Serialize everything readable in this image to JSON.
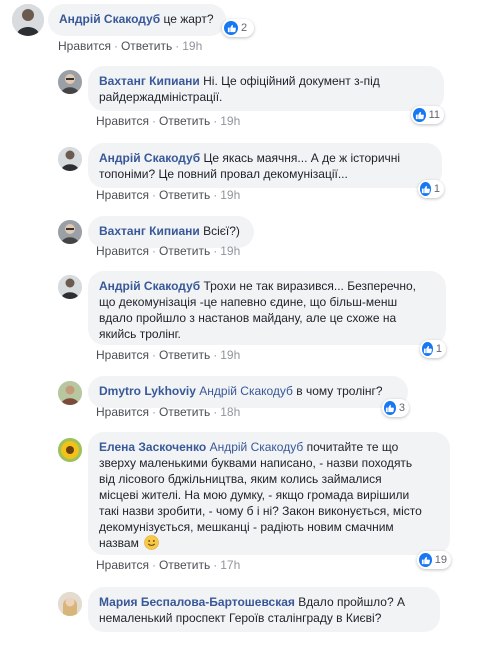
{
  "actions": {
    "like": "Нравится",
    "reply": "Ответить",
    "separator": "·"
  },
  "colors": {
    "author": "#385898",
    "bubble": "#f2f3f5",
    "like_badge": "#1877f2"
  },
  "comments": [
    {
      "author": "Андрій Скакодуб",
      "mention": "",
      "lines": [
        "це жарт?"
      ],
      "time": "19h",
      "likes": "2",
      "avatar": "avatar-man-dark-jacket"
    },
    {
      "author": "Вахтанг Кипиани",
      "mention": "",
      "lines": [
        "Ні. Це офіційний документ з-під",
        "райдержадміністрації."
      ],
      "time": "19h",
      "likes": "11",
      "avatar": "avatar-man-glasses"
    },
    {
      "author": "Андрій Скакодуб",
      "mention": "",
      "lines": [
        "Це якась маячня... А де ж історичні",
        "топоніми? Це повний провал декомунізації..."
      ],
      "time": "19h",
      "likes": "1",
      "avatar": "avatar-man-dark-jacket"
    },
    {
      "author": "Вахтанг Кипиани",
      "mention": "",
      "lines": [
        "Всієї?)"
      ],
      "time": "19h",
      "likes": "",
      "avatar": "avatar-man-glasses"
    },
    {
      "author": "Андрій Скакодуб",
      "mention": "",
      "lines": [
        "Трохи не так виразився... Безперечно,",
        "що декомунізація -це напевно єдине, що більш-менш",
        "вдало пройшло з настанов майдану, але це схоже на",
        "якийсь тролінг."
      ],
      "time": "19h",
      "likes": "1",
      "avatar": "avatar-man-dark-jacket"
    },
    {
      "author": "Dmytro Lykhoviy",
      "mention": "Андрій Скакодуб",
      "lines": [
        "в чому тролінг?"
      ],
      "time": "18h",
      "likes": "3",
      "avatar": "avatar-man-outdoor"
    },
    {
      "author": "Елена Заскоченко",
      "mention": "Андрій Скакодуб",
      "lines": [
        "почитайте те що",
        "зверху маленькими буквами написано, - назви походять",
        "від лісового бджільництва, яким колись займалися",
        "місцеві жителі. На мою думку, - якщо громада вирішили",
        "такі назви зробити, - чому б і ні? Закон виконується, місто",
        "декомунізується, мешканці - радіють новим смачним",
        "назвам"
      ],
      "time": "17h",
      "likes": "19",
      "avatar": "avatar-sunflower"
    },
    {
      "author": "Мария Беспалова-Бартошевская",
      "mention": "",
      "lines": [
        "Вдало пройшло? А",
        "немаленький проспект Героїв сталінграду в Києві?"
      ],
      "time": "",
      "likes": "",
      "avatar": "avatar-woman-blonde"
    }
  ]
}
